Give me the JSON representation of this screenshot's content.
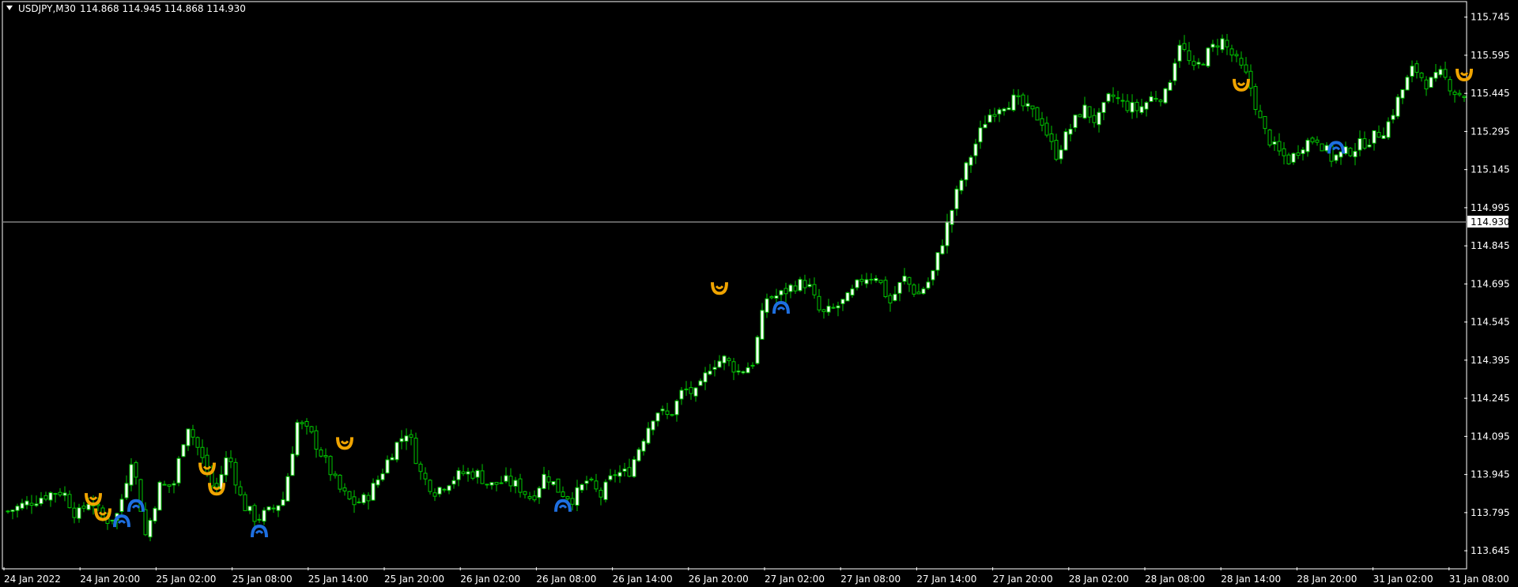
{
  "header": {
    "symbol": "USDJPY,M30",
    "ohlc": "114.868 114.945 114.868 114.930"
  },
  "colors": {
    "background": "#000000",
    "frame": "#ffffff",
    "bull_body": "#ffffff",
    "bear_body": "#000000",
    "wick": "#00c800",
    "bid_line": "#c0c0c0",
    "buy_arrow": "#1e6fe0",
    "sell_arrow": "#f0a400"
  },
  "chart_data": {
    "type": "candlestick",
    "symbol": "USDJPY",
    "timeframe": "M30",
    "ylim": [
      113.58,
      115.8
    ],
    "y_ticks": [
      "115.745",
      "115.595",
      "115.445",
      "115.295",
      "115.145",
      "114.995",
      "114.845",
      "114.695",
      "114.545",
      "114.395",
      "114.245",
      "114.095",
      "113.945",
      "113.795",
      "113.645"
    ],
    "x_ticks": [
      "24 Jan 2022",
      "24 Jan 20:00",
      "25 Jan 02:00",
      "25 Jan 08:00",
      "25 Jan 14:00",
      "25 Jan 20:00",
      "26 Jan 02:00",
      "26 Jan 08:00",
      "26 Jan 14:00",
      "26 Jan 20:00",
      "27 Jan 02:00",
      "27 Jan 08:00",
      "27 Jan 14:00",
      "27 Jan 20:00",
      "28 Jan 02:00",
      "28 Jan 08:00",
      "28 Jan 14:00",
      "28 Jan 20:00",
      "31 Jan 02:00",
      "31 Jan 08:00"
    ],
    "current_price": "114.930",
    "close_path": [
      [
        0,
        113.8
      ],
      [
        6,
        113.87
      ],
      [
        8,
        113.88
      ],
      [
        10,
        113.78
      ],
      [
        12,
        113.85
      ],
      [
        14,
        113.76
      ],
      [
        16,
        113.79
      ],
      [
        18,
        114.02
      ],
      [
        20,
        113.7
      ],
      [
        22,
        113.9
      ],
      [
        24,
        113.9
      ],
      [
        26,
        114.15
      ],
      [
        28,
        114.02
      ],
      [
        30,
        113.87
      ],
      [
        32,
        114.03
      ],
      [
        34,
        113.83
      ],
      [
        36,
        113.77
      ],
      [
        38,
        113.8
      ],
      [
        40,
        113.85
      ],
      [
        42,
        114.15
      ],
      [
        44,
        114.1
      ],
      [
        46,
        114.0
      ],
      [
        48,
        113.89
      ],
      [
        50,
        113.83
      ],
      [
        52,
        113.85
      ],
      [
        54,
        113.94
      ],
      [
        56,
        114.05
      ],
      [
        58,
        114.12
      ],
      [
        60,
        113.94
      ],
      [
        62,
        113.88
      ],
      [
        64,
        113.92
      ],
      [
        66,
        113.95
      ],
      [
        68,
        113.95
      ],
      [
        70,
        113.9
      ],
      [
        72,
        113.92
      ],
      [
        74,
        113.9
      ],
      [
        76,
        113.85
      ],
      [
        78,
        113.95
      ],
      [
        80,
        113.88
      ],
      [
        82,
        113.85
      ],
      [
        84,
        113.92
      ],
      [
        86,
        113.86
      ],
      [
        88,
        113.95
      ],
      [
        90,
        113.95
      ],
      [
        92,
        114.08
      ],
      [
        94,
        114.2
      ],
      [
        96,
        114.17
      ],
      [
        98,
        114.28
      ],
      [
        100,
        114.26
      ],
      [
        102,
        114.38
      ],
      [
        104,
        114.4
      ],
      [
        106,
        114.35
      ],
      [
        108,
        114.38
      ],
      [
        110,
        114.64
      ],
      [
        112,
        114.65
      ],
      [
        114,
        114.69
      ],
      [
        116,
        114.7
      ],
      [
        118,
        114.57
      ],
      [
        120,
        114.6
      ],
      [
        122,
        114.64
      ],
      [
        124,
        114.72
      ],
      [
        126,
        114.73
      ],
      [
        128,
        114.62
      ],
      [
        130,
        114.72
      ],
      [
        132,
        114.65
      ],
      [
        134,
        114.72
      ],
      [
        136,
        114.9
      ],
      [
        138,
        115.08
      ],
      [
        140,
        115.22
      ],
      [
        142,
        115.35
      ],
      [
        144,
        115.4
      ],
      [
        146,
        115.42
      ],
      [
        148,
        115.38
      ],
      [
        150,
        115.34
      ],
      [
        152,
        115.2
      ],
      [
        154,
        115.3
      ],
      [
        156,
        115.39
      ],
      [
        158,
        115.33
      ],
      [
        160,
        115.44
      ],
      [
        162,
        115.4
      ],
      [
        164,
        115.38
      ],
      [
        166,
        115.43
      ],
      [
        168,
        115.44
      ],
      [
        170,
        115.65
      ],
      [
        172,
        115.53
      ],
      [
        174,
        115.6
      ],
      [
        176,
        115.66
      ],
      [
        178,
        115.58
      ],
      [
        180,
        115.5
      ],
      [
        182,
        115.31
      ],
      [
        184,
        115.22
      ],
      [
        186,
        115.18
      ],
      [
        188,
        115.25
      ],
      [
        190,
        115.27
      ],
      [
        192,
        115.19
      ],
      [
        194,
        115.21
      ],
      [
        196,
        115.24
      ],
      [
        198,
        115.27
      ],
      [
        200,
        115.31
      ],
      [
        202,
        115.44
      ],
      [
        204,
        115.55
      ],
      [
        206,
        115.48
      ],
      [
        208,
        115.52
      ],
      [
        210,
        115.45
      ],
      [
        212,
        115.43
      ]
    ],
    "markers": [
      {
        "type": "sell",
        "bar": 18,
        "price": 113.85
      },
      {
        "type": "sell",
        "bar": 20,
        "price": 113.79
      },
      {
        "type": "buy",
        "bar": 24,
        "price": 113.76
      },
      {
        "type": "buy",
        "bar": 27,
        "price": 113.82
      },
      {
        "type": "sell",
        "bar": 42,
        "price": 113.97
      },
      {
        "type": "sell",
        "bar": 44,
        "price": 113.89
      },
      {
        "type": "buy",
        "bar": 53,
        "price": 113.72
      },
      {
        "type": "sell",
        "bar": 71,
        "price": 114.07
      },
      {
        "type": "buy",
        "bar": 117,
        "price": 113.82
      },
      {
        "type": "sell",
        "bar": 150,
        "price": 114.68
      },
      {
        "type": "buy",
        "bar": 163,
        "price": 114.6
      },
      {
        "type": "sell",
        "bar": 260,
        "price": 115.48
      },
      {
        "type": "buy",
        "bar": 280,
        "price": 115.23
      },
      {
        "type": "sell",
        "bar": 307,
        "price": 115.52
      }
    ]
  }
}
